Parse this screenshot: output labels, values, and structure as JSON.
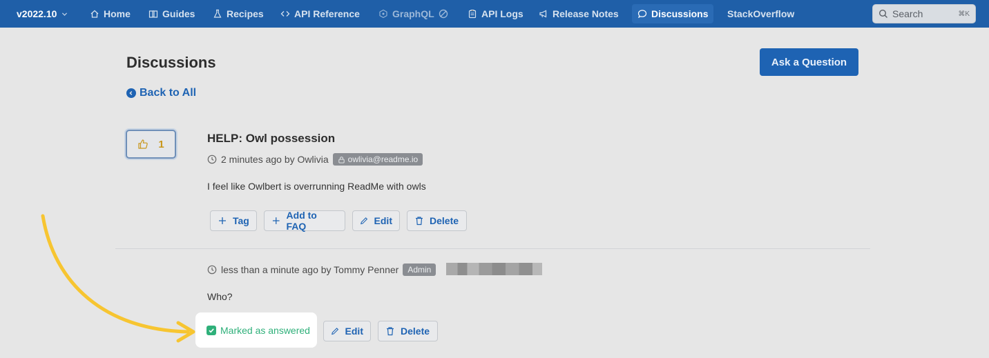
{
  "nav": {
    "version": "v2022.10",
    "items": [
      {
        "label": "Home",
        "icon": "home-icon"
      },
      {
        "label": "Guides",
        "icon": "book-icon"
      },
      {
        "label": "Recipes",
        "icon": "flask-icon"
      },
      {
        "label": "API Reference",
        "icon": "code-icon"
      },
      {
        "label": "GraphQL",
        "icon": "graphql-icon"
      },
      {
        "label": "API Logs",
        "icon": "clipboard-icon"
      },
      {
        "label": "Release Notes",
        "icon": "megaphone-icon"
      },
      {
        "label": "Discussions",
        "icon": "chat-icon"
      },
      {
        "label": "StackOverflow",
        "icon": ""
      }
    ],
    "search_placeholder": "Search",
    "search_shortcut": "⌘K"
  },
  "page": {
    "title": "Discussions",
    "ask_button": "Ask a Question",
    "back_link": "Back to All"
  },
  "question": {
    "votes": "1",
    "title": "HELP: Owl possession",
    "time": "2 minutes ago by Owlivia",
    "email_badge": "owlivia@readme.io",
    "body": "I feel like Owlbert is overrunning ReadMe with owls",
    "actions": {
      "tag": "Tag",
      "faq": "Add to FAQ",
      "edit": "Edit",
      "delete": "Delete"
    }
  },
  "answer": {
    "time": "less than a minute ago by Tommy Penner",
    "role_badge": "Admin",
    "body": "Who?",
    "marked": "Marked as answered",
    "actions": {
      "edit": "Edit",
      "delete": "Delete"
    }
  },
  "colors": {
    "nav_bg": "#1f5fa8",
    "accent": "#1e63b3",
    "answered_green": "#2fb07a",
    "arrow_yellow": "#f7c531"
  }
}
